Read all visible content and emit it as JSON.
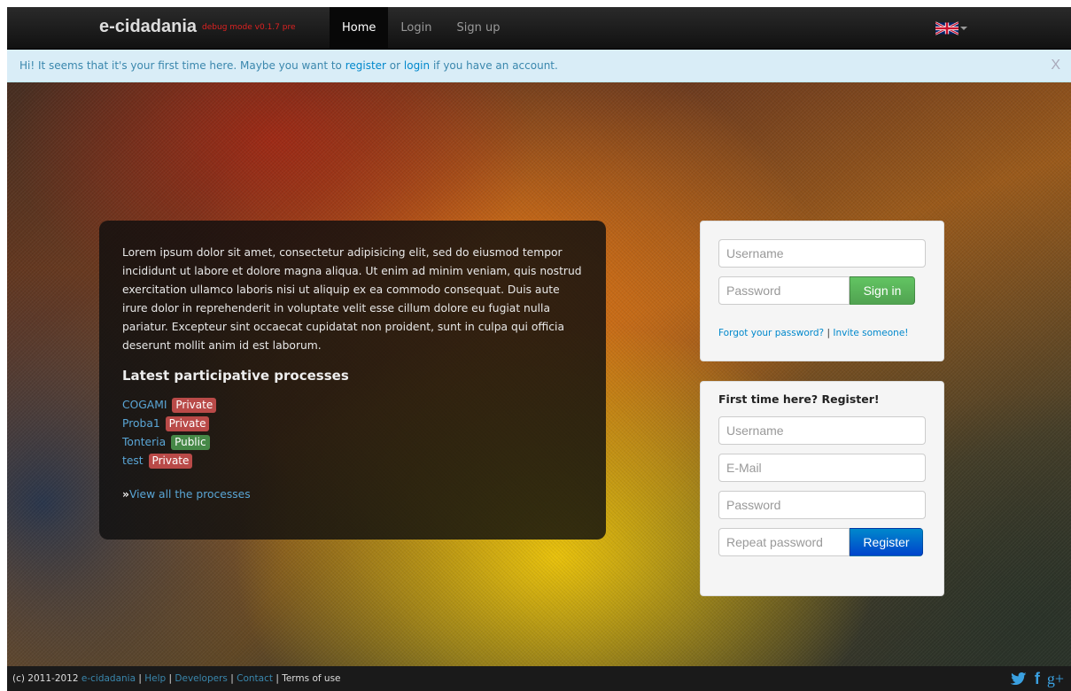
{
  "navbar": {
    "brand": "e-cidadania",
    "version": "debug mode v0.1.7 pre",
    "links": [
      {
        "label": "Home",
        "active": true
      },
      {
        "label": "Login",
        "active": false
      },
      {
        "label": "Sign up",
        "active": false
      }
    ],
    "language_icon": "uk-flag-icon"
  },
  "alert": {
    "text_before": "Hi! It seems that it's your first time here. Maybe you want to ",
    "register_link": "register",
    "text_middle": " or ",
    "login_link": "login",
    "text_after": " if you have an account.",
    "close_label": "X"
  },
  "intro": {
    "paragraph": "Lorem ipsum dolor sit amet, consectetur adipisicing elit, sed do eiusmod tempor incididunt ut labore et dolore magna aliqua. Ut enim ad minim veniam, quis nostrud exercitation ullamco laboris nisi ut aliquip ex ea commodo consequat. Duis aute irure dolor in reprehenderit in voluptate velit esse cillum dolore eu fugiat nulla pariatur. Excepteur sint occaecat cupidatat non proident, sunt in culpa qui officia deserunt mollit anim id est laborum.",
    "processes_title": "Latest participative processes",
    "processes": [
      {
        "name": "COGAMI",
        "visibility": "Private"
      },
      {
        "name": "Proba1",
        "visibility": "Private"
      },
      {
        "name": "Tonteria",
        "visibility": "Public"
      },
      {
        "name": "test",
        "visibility": "Private"
      }
    ],
    "view_all_prefix": "»",
    "view_all": "View all the processes"
  },
  "login": {
    "username_placeholder": "Username",
    "password_placeholder": "Password",
    "signin_label": "Sign in",
    "forgot_label": "Forgot your password?",
    "separator": " | ",
    "invite_label": "Invite someone!"
  },
  "register": {
    "title": "First time here? Register!",
    "username_placeholder": "Username",
    "email_placeholder": "E-Mail",
    "password_placeholder": "Password",
    "repeat_placeholder": "Repeat password",
    "register_label": "Register"
  },
  "footer": {
    "copyright": "(c) 2011-2012 ",
    "site_link": "e-cidadania",
    "sep1": " | ",
    "help": "Help",
    "sep2": " | ",
    "developers": "Developers",
    "sep3": " | ",
    "contact": "Contact",
    "sep4": " | ",
    "terms": "Terms of use",
    "social": [
      "twitter-icon",
      "facebook-icon",
      "google-plus-icon"
    ],
    "facebook_glyph": "f",
    "gplus_glyph": "g+"
  }
}
